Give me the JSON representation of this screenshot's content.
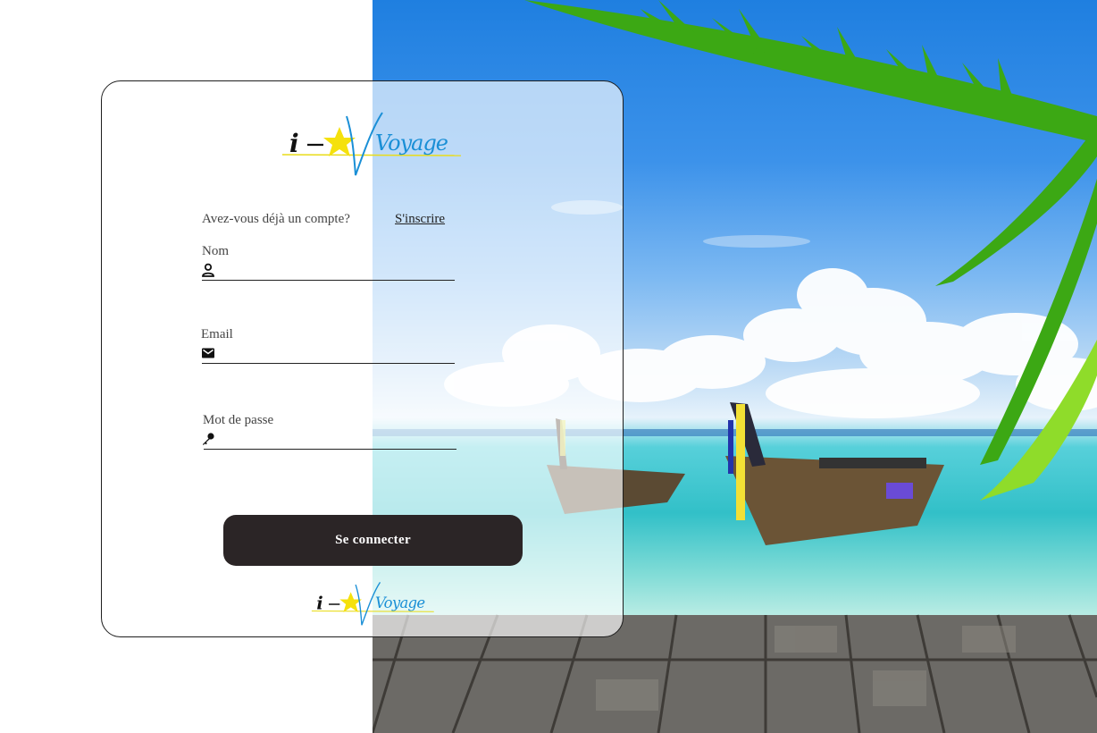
{
  "brand": {
    "logo_letter": "i",
    "logo_word": "Voyage"
  },
  "login": {
    "question": "Avez-vous déjà un compte?",
    "signup_link": "S'inscrire",
    "fields": {
      "name": {
        "label": "Nom",
        "icon": "person-icon",
        "value": ""
      },
      "email": {
        "label": "Email",
        "icon": "envelope-icon",
        "value": ""
      },
      "password": {
        "label": "Mot de passe",
        "icon": "key-icon",
        "value": ""
      }
    },
    "submit_label": "Se connecter"
  },
  "colors": {
    "button": "#2b2526",
    "logo_blue": "#1a8fd6",
    "logo_star": "#f5e10c"
  }
}
